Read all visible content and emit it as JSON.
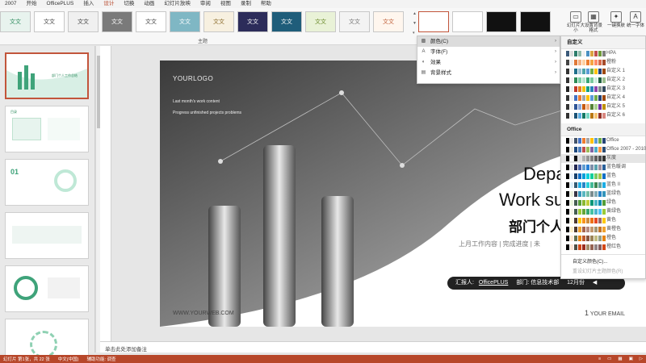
{
  "ribbon_tabs": [
    "2007",
    "开始",
    "OfficePLUS",
    "插入",
    "设计",
    "切换",
    "动画",
    "幻灯片放映",
    "审阅",
    "视图",
    "录制",
    "帮助"
  ],
  "active_tab": "设计",
  "themes_group_label": "主题",
  "theme_thumb_text": "文文",
  "ribbon_buttons": {
    "slide_size": "幻灯片大小",
    "format_background": "设置背景格式",
    "one_click_beautify": "一键换肤",
    "unify_font": "统一字体"
  },
  "thumbnails": [
    {
      "text": "部门个人工作总结"
    },
    {
      "text": "目录"
    },
    {
      "text": "01"
    },
    {
      "text": ""
    },
    {
      "text": ""
    },
    {
      "text": ""
    }
  ],
  "slide": {
    "logo": "YOURLOGO",
    "line1": "Last month's work content",
    "line2": "Progress   unfinished projects   problems",
    "title_en_1": "Depa",
    "title_en_2": "Work su",
    "title_cn": "部门个人",
    "subtitle": "上月工作内容  |  完成进度  |  未",
    "reporter_label": "汇报人:",
    "reporter_name": "OfficePLUS",
    "department": "部门: 信息技术部",
    "month": "12月份",
    "web": "WWW.YOURWEB.COM",
    "email_num": "1",
    "email": "YOUR EMAIL"
  },
  "notes_placeholder": "单击此处添加备注",
  "status": {
    "slide_info": "幻灯片 第1张，共 22 张",
    "language": "中文(中国)",
    "accessibility": "辅助功能: 调查"
  },
  "menu": {
    "items": [
      {
        "label": "颜色(C)",
        "icon": "palette-icon"
      },
      {
        "label": "字体(F)",
        "icon": "font-icon"
      },
      {
        "label": "效果",
        "icon": "effects-icon"
      },
      {
        "label": "背景样式",
        "icon": "background-icon"
      }
    ]
  },
  "colors_submenu": {
    "custom_header": "自定义",
    "custom": [
      {
        "name": "HPA",
        "colors": [
          "#3b5a7a",
          "#dcdcdc",
          "#2e7d6b",
          "#8fb9a8",
          "#f1f1f1",
          "#4a90c2",
          "#d9a441",
          "#c0504d",
          "#6f9a3a",
          "#7f7f7f"
        ]
      },
      {
        "name": "橙粉",
        "colors": [
          "#444",
          "#eeeeee",
          "#e07a3a",
          "#f4b183",
          "#ffd1a4",
          "#ed7d31",
          "#f5a442",
          "#ff8c69",
          "#d96c4a",
          "#a64b2a"
        ]
      },
      {
        "name": "自定义 1",
        "colors": [
          "#333",
          "#f2f2f2",
          "#1f6f8b",
          "#99c1d5",
          "#4da4a9",
          "#5b9bd5",
          "#70ad47",
          "#ffc000",
          "#264478",
          "#9e480e"
        ]
      },
      {
        "name": "自定义 2",
        "colors": [
          "#333",
          "#f2f2f2",
          "#2e8b57",
          "#7dcfa8",
          "#b6e3ce",
          "#3aa676",
          "#79c99e",
          "#d2efe0",
          "#205f41",
          "#9bbf8e"
        ]
      },
      {
        "name": "自定义 3",
        "colors": [
          "#222",
          "#eeeeee",
          "#c0392b",
          "#e67e22",
          "#f1c40f",
          "#16a085",
          "#2980b9",
          "#8e44ad",
          "#7f8c8d",
          "#34495e"
        ]
      },
      {
        "name": "自定义 4",
        "colors": [
          "#333",
          "#f2f2f2",
          "#4472c4",
          "#ed7d31",
          "#a5a5a5",
          "#ffc000",
          "#5b9bd5",
          "#70ad47",
          "#264478",
          "#9e480e"
        ]
      },
      {
        "name": "自定义 5",
        "colors": [
          "#333",
          "#f2f2f2",
          "#2f5597",
          "#8faadc",
          "#c55a11",
          "#f4b183",
          "#548235",
          "#a9d18e",
          "#7030a0",
          "#bf9000"
        ]
      },
      {
        "name": "自定义 6",
        "colors": [
          "#333",
          "#f2f2f2",
          "#1a5276",
          "#5dade2",
          "#117864",
          "#76d7c4",
          "#b9770e",
          "#f8c471",
          "#943126",
          "#d98880"
        ]
      }
    ],
    "office_header": "Office",
    "office": [
      {
        "name": "Office",
        "colors": [
          "#000000",
          "#e7e6e6",
          "#44546a",
          "#4472c4",
          "#ed7d31",
          "#a5a5a5",
          "#ffc000",
          "#5b9bd5",
          "#70ad47",
          "#264478"
        ]
      },
      {
        "name": "Office 2007 - 2010",
        "colors": [
          "#000000",
          "#eeece1",
          "#1f497d",
          "#4f81bd",
          "#c0504d",
          "#9bbb59",
          "#8064a2",
          "#4bacc6",
          "#f79646",
          "#2c4d75"
        ]
      },
      {
        "name": "灰度",
        "colors": [
          "#000000",
          "#f8f8f8",
          "#111111",
          "#dddddd",
          "#b2b2b2",
          "#969696",
          "#808080",
          "#5f5f5f",
          "#4d4d4d",
          "#333333"
        ]
      },
      {
        "name": "蓝色暖调",
        "colors": [
          "#000000",
          "#e6e6e6",
          "#242852",
          "#4a66ac",
          "#629dd1",
          "#297fd5",
          "#7f8fa9",
          "#5aa2ae",
          "#9d90a0",
          "#2a6099"
        ]
      },
      {
        "name": "蓝色",
        "colors": [
          "#000000",
          "#e6f0fa",
          "#17406d",
          "#0f6fc6",
          "#009dd9",
          "#0bd0d9",
          "#10cf9b",
          "#7cca62",
          "#a5c249",
          "#0f6fc6"
        ]
      },
      {
        "name": "蓝色 II",
        "colors": [
          "#000000",
          "#dbeff9",
          "#335b74",
          "#1cade4",
          "#2683c6",
          "#27ced7",
          "#42ba97",
          "#3e8853",
          "#62a39f",
          "#1cade4"
        ]
      },
      {
        "name": "蓝绿色",
        "colors": [
          "#000000",
          "#ebf1de",
          "#373545",
          "#3494ba",
          "#58b6c0",
          "#75bda7",
          "#7a8c8e",
          "#84acb6",
          "#2683c6",
          "#3494ba"
        ]
      },
      {
        "name": "绿色",
        "colors": [
          "#000000",
          "#e9f5db",
          "#455f51",
          "#549e39",
          "#8ab833",
          "#c0cf3a",
          "#029676",
          "#4ab5c4",
          "#0989b1",
          "#549e39"
        ]
      },
      {
        "name": "黄绿色",
        "colors": [
          "#000000",
          "#f2f4e7",
          "#455f51",
          "#99cb38",
          "#63a537",
          "#37a76f",
          "#44c1a3",
          "#4eb3cf",
          "#51c3f9",
          "#99cb38"
        ]
      },
      {
        "name": "黄色",
        "colors": [
          "#000000",
          "#fffbe6",
          "#4e3b30",
          "#ffca08",
          "#f8931d",
          "#ce8d3e",
          "#ec7016",
          "#e64823",
          "#9c6a6a",
          "#ffca08"
        ]
      },
      {
        "name": "黄橙色",
        "colors": [
          "#000000",
          "#fbeec9",
          "#4e3b30",
          "#f0a22e",
          "#a5644e",
          "#b58b80",
          "#c3986d",
          "#a19574",
          "#c17529",
          "#f0a22e"
        ]
      },
      {
        "name": "橙色",
        "colors": [
          "#000000",
          "#fde8d3",
          "#637052",
          "#e48312",
          "#bd582c",
          "#865640",
          "#9b8357",
          "#c2bc80",
          "#94a088",
          "#e48312"
        ]
      },
      {
        "name": "橙红色",
        "colors": [
          "#000000",
          "#fbe4d5",
          "#505046",
          "#d34817",
          "#9b2d1f",
          "#a28e6a",
          "#956251",
          "#918485",
          "#855d5d",
          "#d34817"
        ]
      }
    ],
    "highlighted": "灰度",
    "custom_colors_action": "自定义颜色(C)...",
    "reset_action": "重设幻灯片主题颜色(R)"
  },
  "colors": {
    "accent": "#b7472a",
    "slide_grey_dark": "#3a3a3a",
    "slide_grey_light": "#d9d9d9"
  }
}
